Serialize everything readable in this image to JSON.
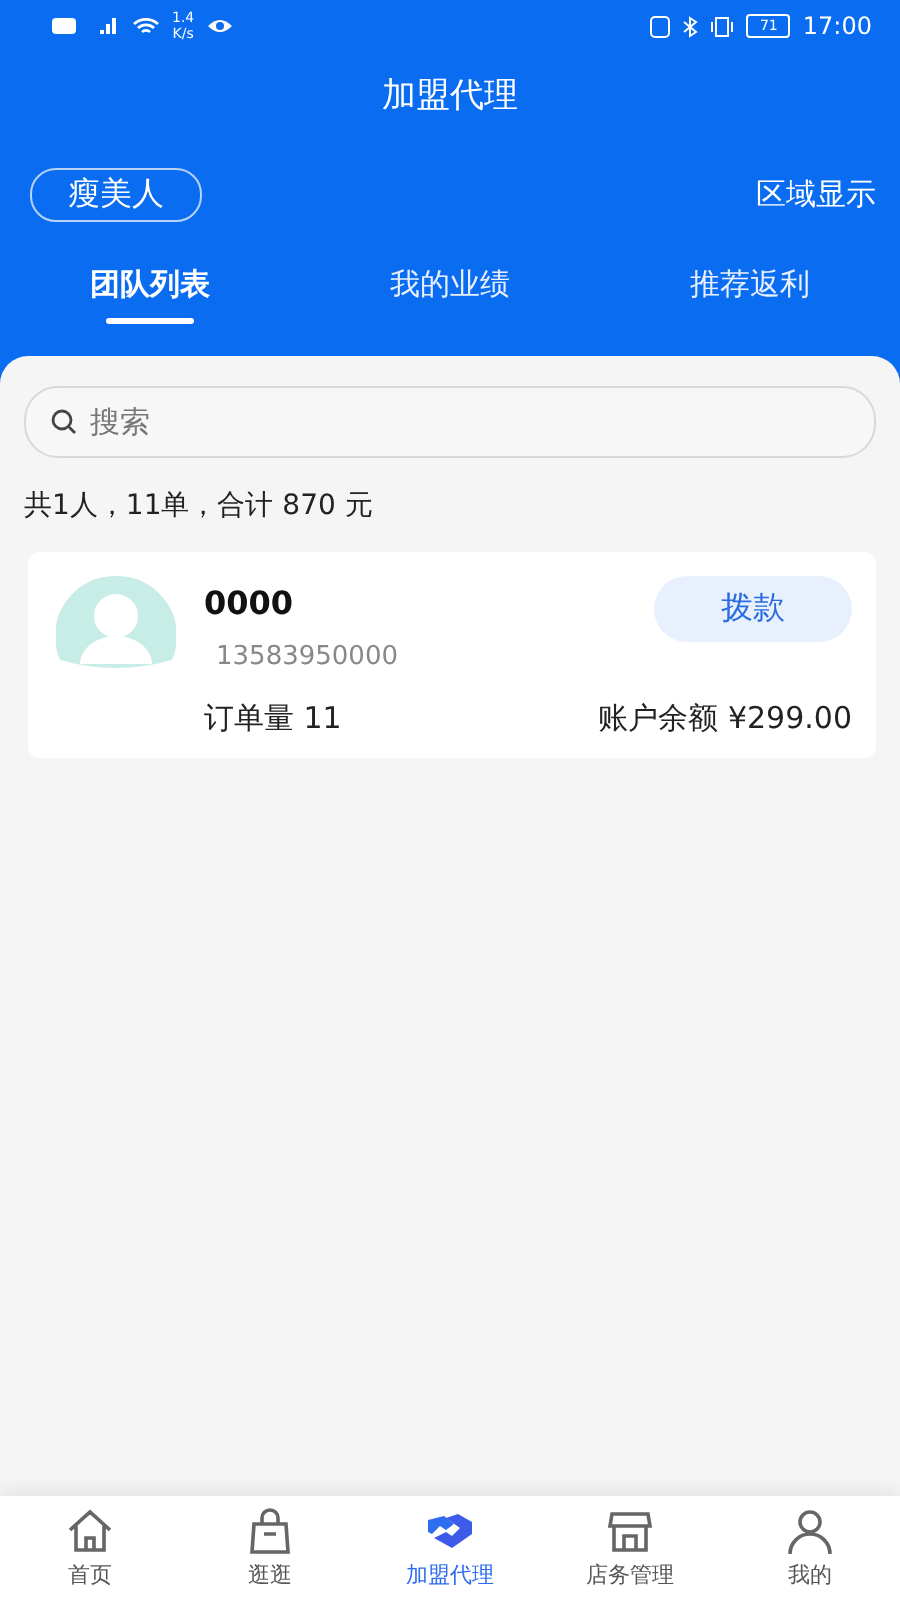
{
  "status_bar": {
    "speed_value": "1.4",
    "speed_unit": "K/s",
    "battery": "71",
    "time": "17:00"
  },
  "header": {
    "title": "加盟代理",
    "region_chip": "瘦美人",
    "region_link": "区域显示"
  },
  "tabs": [
    {
      "label": "团队列表",
      "selected": true
    },
    {
      "label": "我的业绩",
      "selected": false
    },
    {
      "label": "推荐返利",
      "selected": false
    }
  ],
  "search": {
    "placeholder": "搜索"
  },
  "summary": "共1人，11单，合计 870 元",
  "members": [
    {
      "name": "0000",
      "phone": "13583950000",
      "action": "拨款",
      "orders_label": "订单量",
      "orders": "11",
      "balance_label": "账户余额",
      "balance": "¥299.00"
    }
  ],
  "bottom_nav": [
    {
      "kind": "home",
      "label": "首页",
      "selected": false
    },
    {
      "kind": "bag",
      "label": "逛逛",
      "selected": false
    },
    {
      "kind": "handshake",
      "label": "加盟代理",
      "selected": true
    },
    {
      "kind": "store",
      "label": "店务管理",
      "selected": false
    },
    {
      "kind": "person",
      "label": "我的",
      "selected": false
    }
  ]
}
